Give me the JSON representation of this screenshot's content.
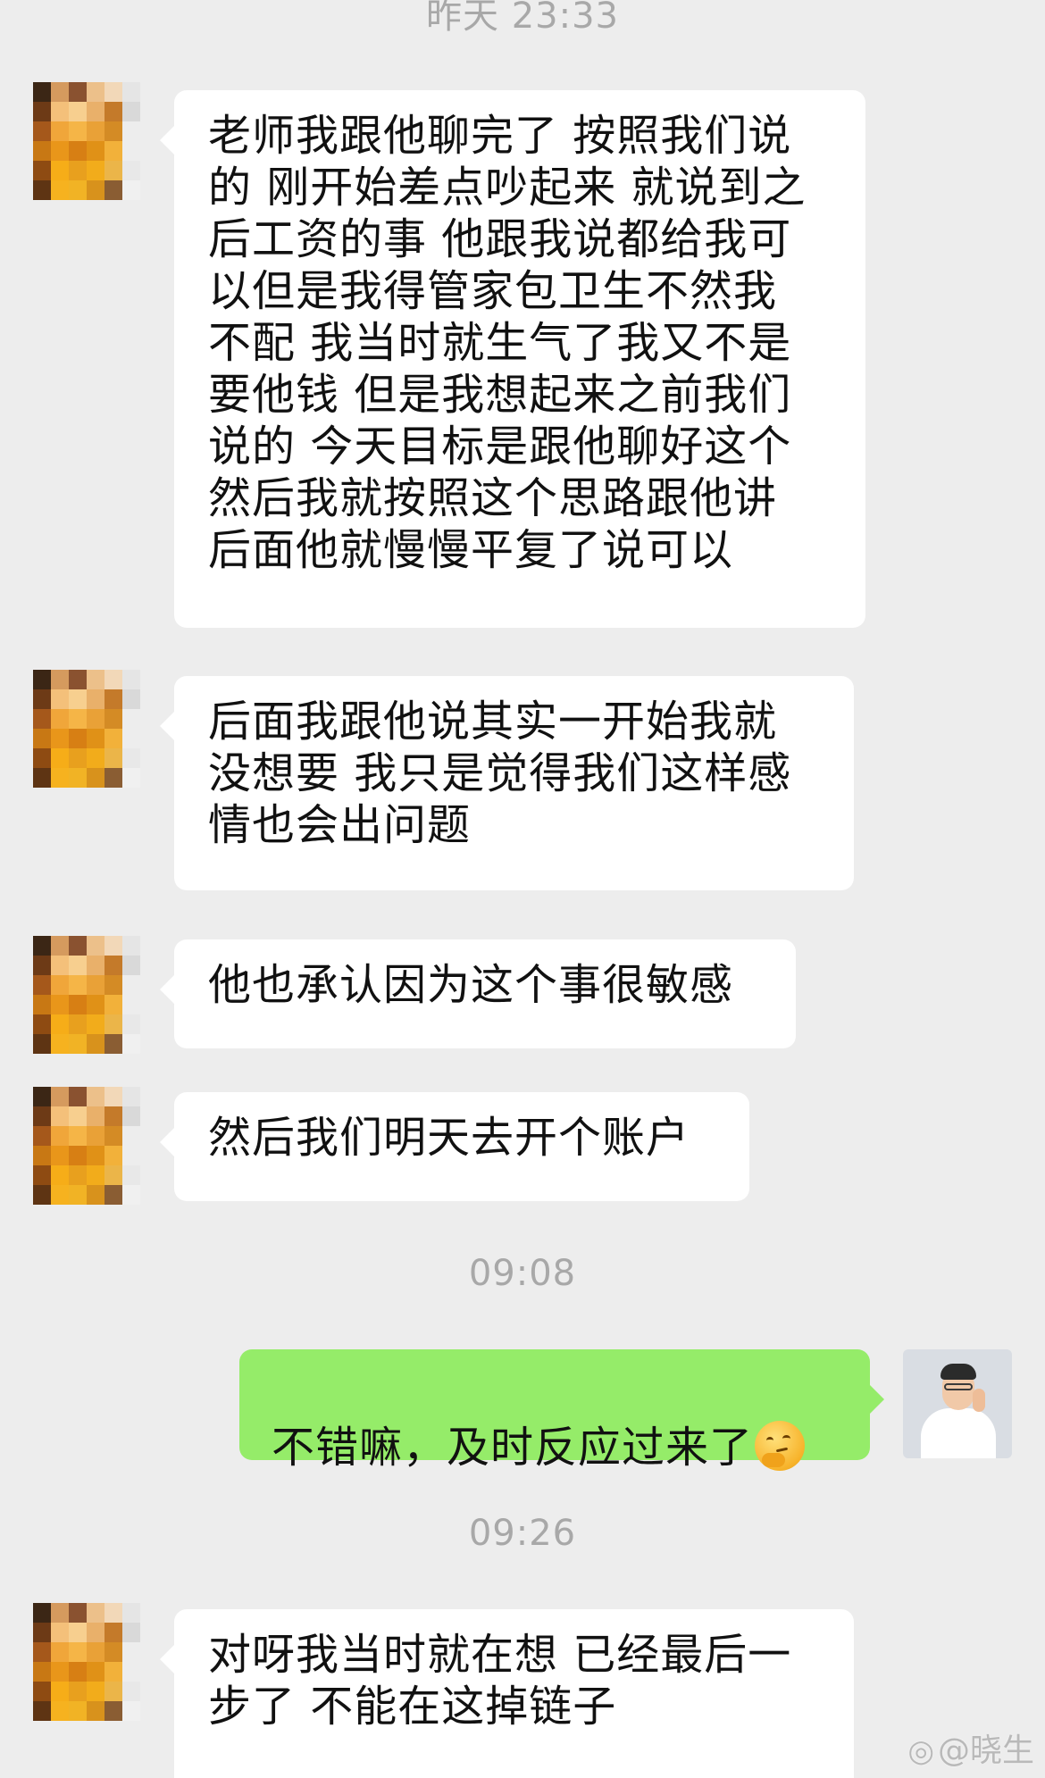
{
  "colors": {
    "background": "#ededed",
    "incoming_bubble": "#ffffff",
    "outgoing_bubble": "#95ec69",
    "timestamp_text": "#a8a8a8"
  },
  "timestamps": {
    "t1": "昨天 23:33",
    "t2": "09:08",
    "t3": "09:26"
  },
  "messages": {
    "m1": "老师我跟他聊完了 按照我们说\n的 刚开始差点吵起来 就说到之\n后工资的事 他跟我说都给我可\n以但是我得管家包卫生不然我\n不配 我当时就生气了我又不是\n要他钱 但是我想起来之前我们\n说的 今天目标是跟他聊好这个\n然后我就按照这个思路跟他讲\n后面他就慢慢平复了说可以",
    "m2": "后面我跟他说其实一开始我就\n没想要 我只是觉得我们这样感\n情也会出问题",
    "m3": "他也承认因为这个事很敏感",
    "m4": "然后我们明天去开个账户",
    "m5": "不错嘛，及时反应过来了",
    "m5_emoji": "thinking-face-emoji",
    "m6": "对呀我当时就在想 已经最后一\n步了 不能在这掉链子"
  },
  "watermark": {
    "icon": "weibo-icon",
    "text": "@晓生"
  }
}
